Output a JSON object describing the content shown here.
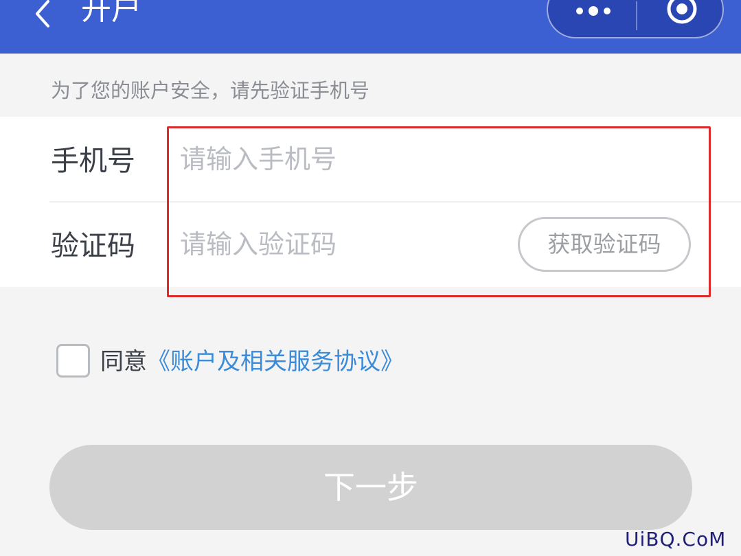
{
  "header": {
    "title": "开户",
    "back_icon": "chevron-left-icon",
    "more_icon": "more-dots-icon",
    "close_icon": "target-circle-icon",
    "color": "#3c60d1"
  },
  "hint": "为了您的账户安全，请先验证手机号",
  "form": {
    "phone": {
      "label": "手机号",
      "placeholder": "请输入手机号",
      "value": ""
    },
    "code": {
      "label": "验证码",
      "placeholder": "请输入验证码",
      "value": "",
      "get_code_label": "获取验证码"
    }
  },
  "agreement": {
    "checked": false,
    "prefix": "同意",
    "link_text": "《账户及相关服务协议》",
    "link_color": "#3b8bd8"
  },
  "next_button": {
    "label": "下一步",
    "enabled": false
  },
  "highlight_color": "#dd2a2a",
  "watermark": "UiBQ.CoM"
}
